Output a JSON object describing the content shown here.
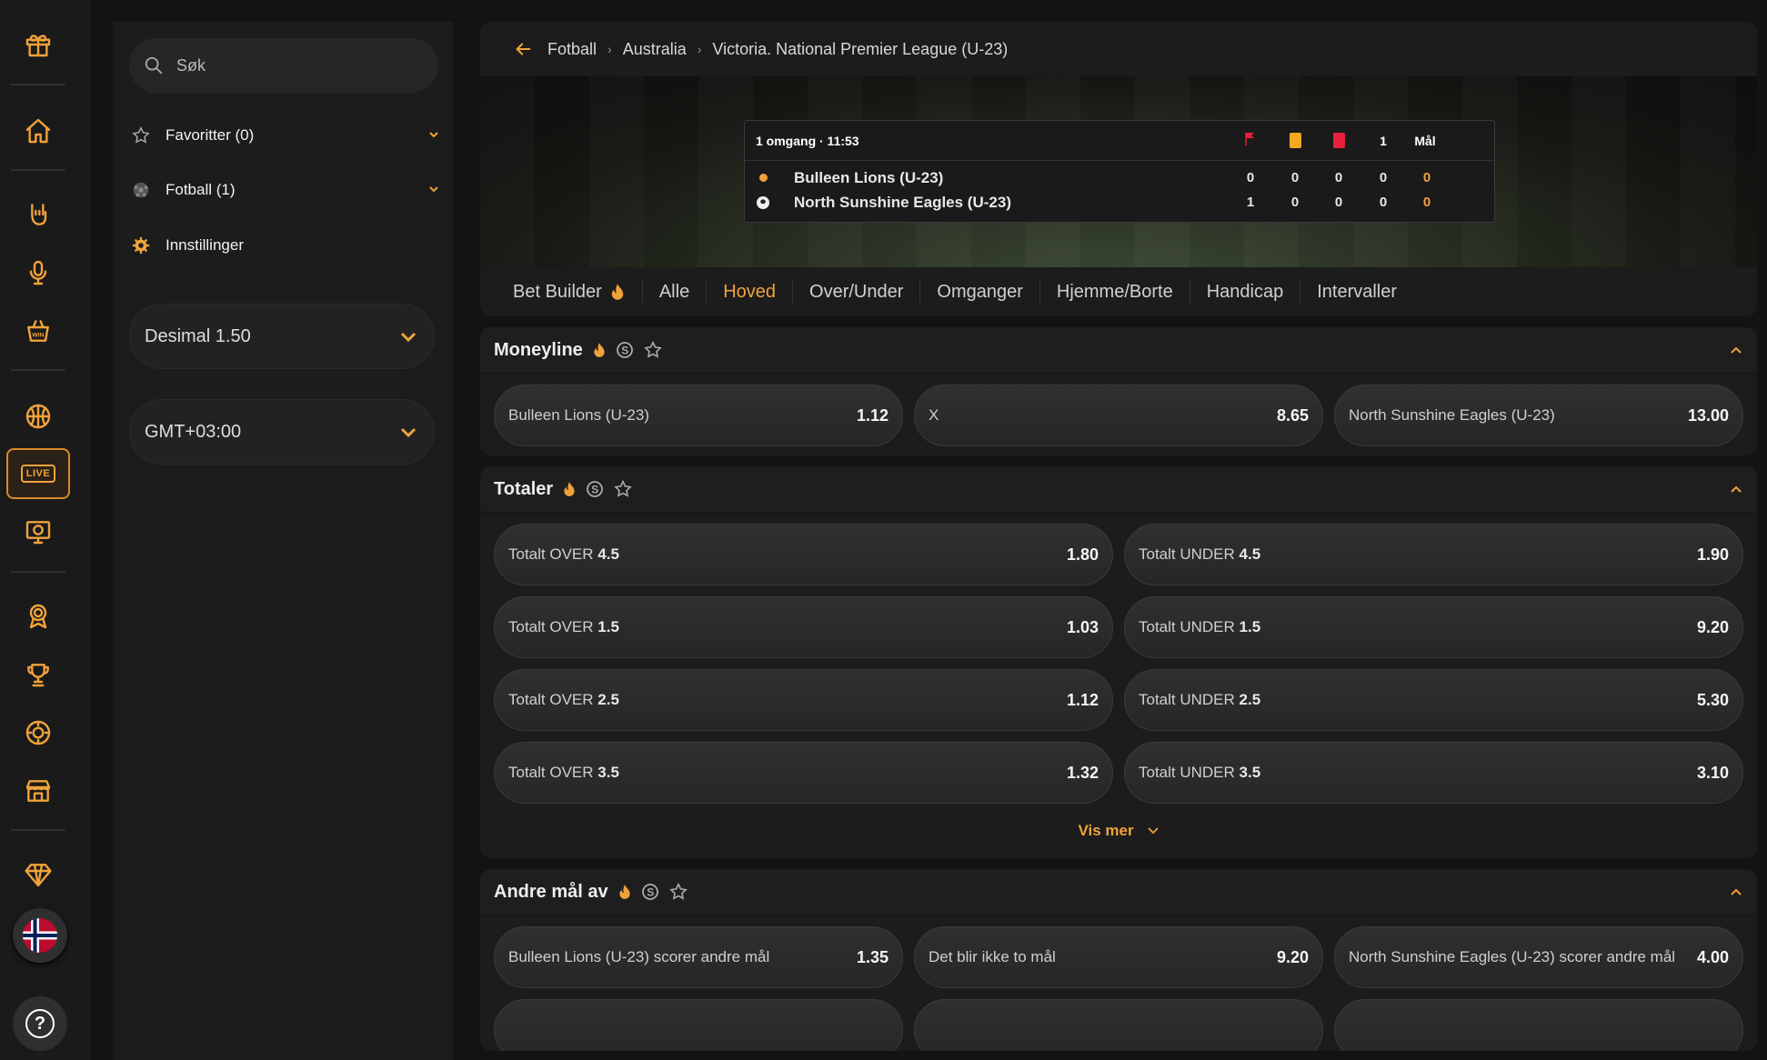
{
  "rail": {
    "icons": [
      "gift-icon",
      "home-icon",
      "rock-hand-icon",
      "microphone-icon",
      "win-basket-icon",
      "basketball-icon",
      "live-icon",
      "tv-football-icon",
      "award-icon",
      "trophy-icon",
      "poker-chip-icon",
      "store-icon",
      "diamond-icon",
      "norway-flag-icon",
      "help-icon"
    ],
    "live_label": "LIVE",
    "help_label": "?"
  },
  "side": {
    "search_placeholder": "Søk",
    "favorites_label": "Favoritter (0)",
    "football_label": "Fotball (1)",
    "settings_label": "Innstillinger",
    "odds_format": "Desimal 1.50",
    "timezone": "GMT+03:00"
  },
  "breadcrumb": {
    "items": [
      "Fotball",
      "Australia",
      "Victoria. National Premier League (U-23)"
    ],
    "separator": "›"
  },
  "scoreboard": {
    "period": "1 omgang · 11:53",
    "col_half": "1",
    "col_goals": "Mål",
    "teams": [
      {
        "name": "Bulleen Lions (U-23)",
        "corners": "0",
        "yellow": "0",
        "red": "0",
        "half": "0",
        "goals": "0"
      },
      {
        "name": "North Sunshine Eagles (U-23)",
        "corners": "1",
        "yellow": "0",
        "red": "0",
        "half": "0",
        "goals": "0"
      }
    ]
  },
  "tabs": [
    "Bet Builder",
    "Alle",
    "Hoved",
    "Over/Under",
    "Omganger",
    "Hjemme/Borte",
    "Handicap",
    "Intervaller"
  ],
  "active_tab": "Hoved",
  "moneyline": {
    "title": "Moneyline",
    "odds": [
      {
        "label": "Bulleen Lions (U-23)",
        "value": "1.12"
      },
      {
        "label": "X",
        "value": "8.65"
      },
      {
        "label": "North Sunshine Eagles (U-23)",
        "value": "13.00"
      }
    ]
  },
  "totals": {
    "title": "Totaler",
    "over_prefix": "Totalt OVER",
    "under_prefix": "Totalt UNDER",
    "rows": [
      {
        "line": "4.5",
        "over": "1.80",
        "under": "1.90"
      },
      {
        "line": "1.5",
        "over": "1.03",
        "under": "9.20"
      },
      {
        "line": "2.5",
        "over": "1.12",
        "under": "5.30"
      },
      {
        "line": "3.5",
        "over": "1.32",
        "under": "3.10"
      }
    ],
    "more_label": "Vis mer"
  },
  "second_goal": {
    "title": "Andre mål av",
    "odds": [
      {
        "label": "Bulleen Lions (U-23) scorer andre mål",
        "value": "1.35"
      },
      {
        "label": "Det blir ikke to mål",
        "value": "9.20"
      },
      {
        "label": "North Sunshine Eagles (U-23) scorer andre mål",
        "value": "4.00"
      }
    ]
  },
  "colors": {
    "accent": "#f0a23a",
    "bg": "#131313",
    "panel": "#1c1c1c",
    "yellow_card": "#f5a623",
    "red_card": "#e8203a"
  }
}
